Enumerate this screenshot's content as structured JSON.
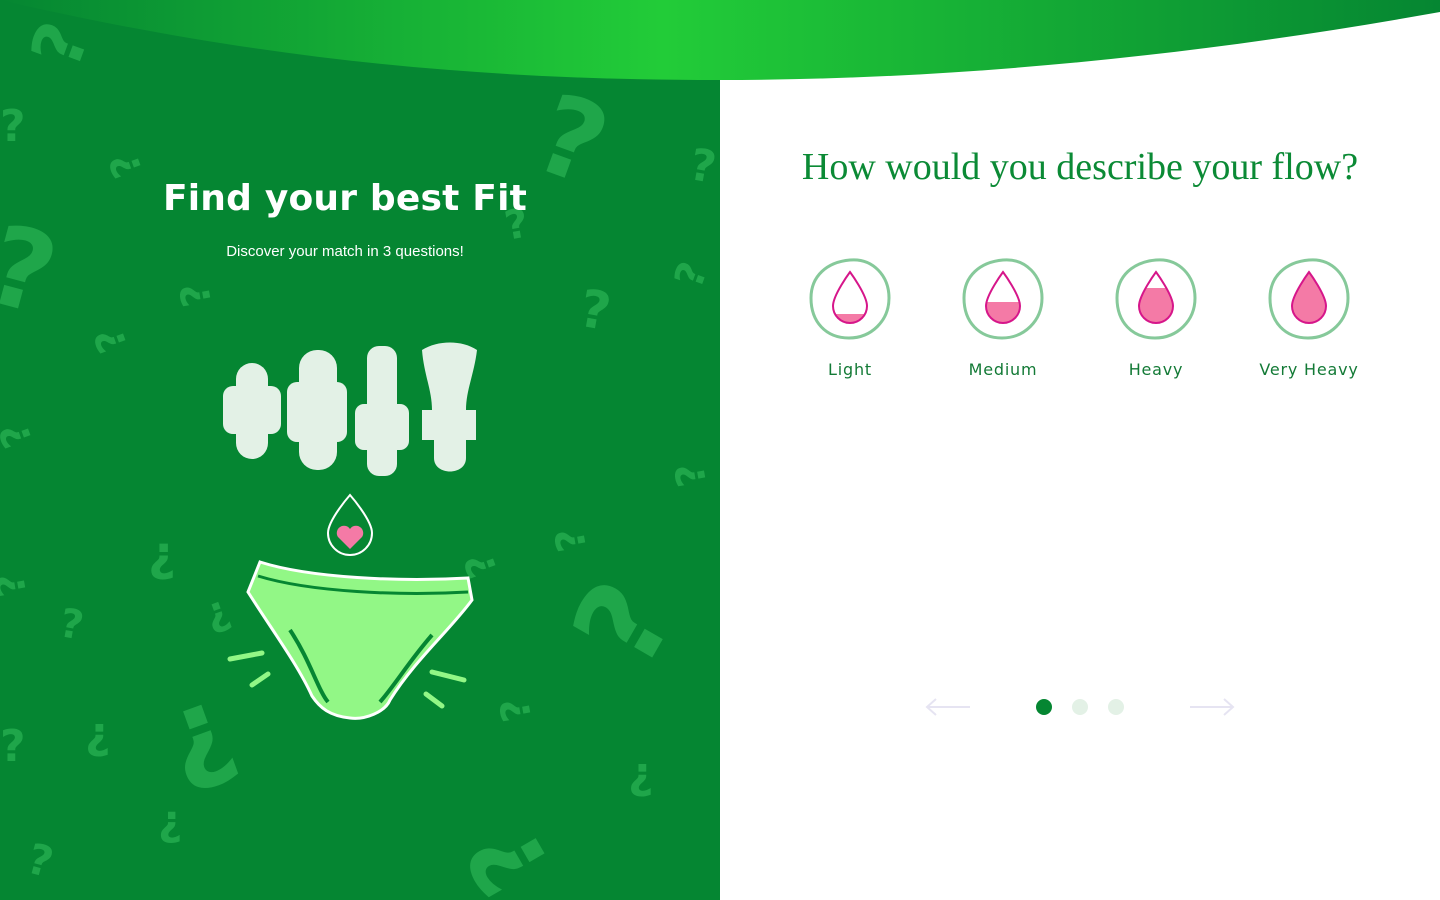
{
  "hero": {
    "title": "Find your best Fit",
    "subtitle": "Discover your match in 3 questions!"
  },
  "quiz": {
    "question": "How would you describe your flow?",
    "options": [
      {
        "label": "Light",
        "icon": "drop-light-icon",
        "fill_level": 0.2
      },
      {
        "label": "Medium",
        "icon": "drop-medium-icon",
        "fill_level": 0.45
      },
      {
        "label": "Heavy",
        "icon": "drop-heavy-icon",
        "fill_level": 0.7
      },
      {
        "label": "Very Heavy",
        "icon": "drop-very-heavy-icon",
        "fill_level": 1.0
      }
    ]
  },
  "carousel": {
    "total_steps": 3,
    "current_step": 1,
    "prev_icon": "arrow-left-icon",
    "next_icon": "arrow-right-icon"
  },
  "colors": {
    "brand_green": "#058632",
    "accent_green": "#0b8a35",
    "bright_green": "#22cc38",
    "pink": "#ff6fa1",
    "magenta": "#d6168a",
    "circle_border": "#86c99a",
    "dot_inactive": "#e3f1e6"
  }
}
